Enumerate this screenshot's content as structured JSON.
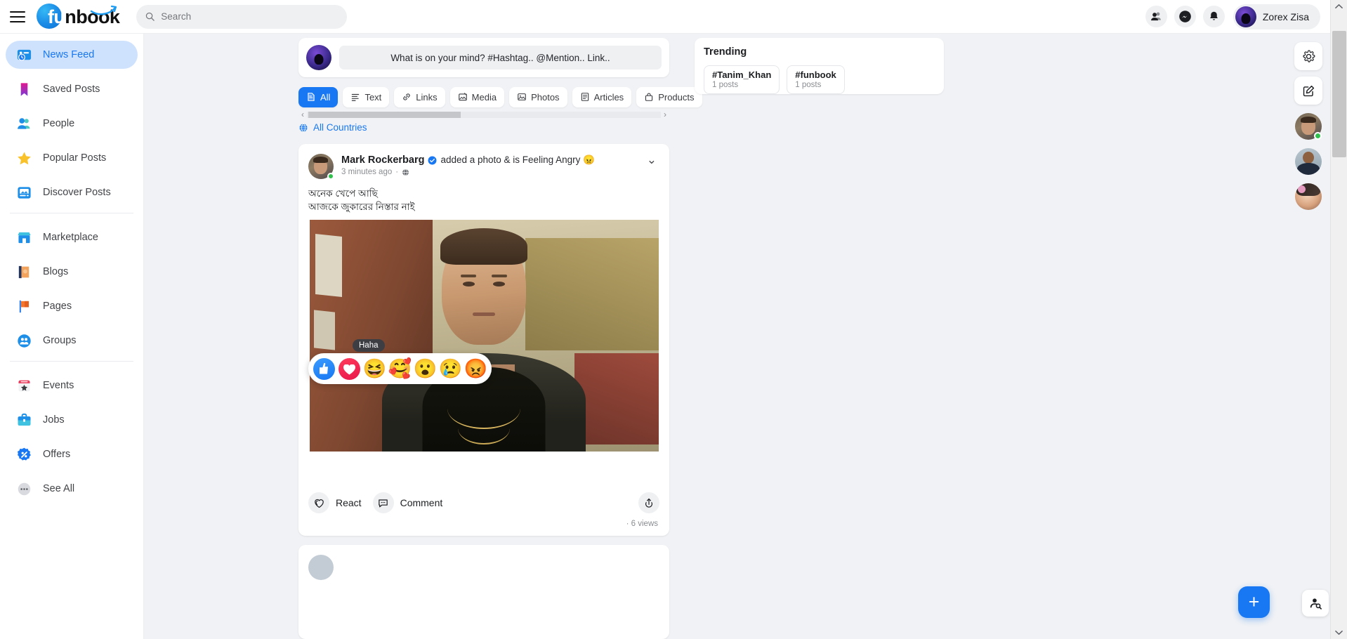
{
  "header": {
    "menu_icon": "hamburger-icon",
    "brand": {
      "prefix": "fu",
      "suffix": "nbook"
    },
    "search": {
      "placeholder": "Search",
      "icon": "search-icon"
    },
    "icons": [
      {
        "name": "friends-icon",
        "glyph": "friends"
      },
      {
        "name": "messenger-icon",
        "glyph": "messenger"
      },
      {
        "name": "notifications-icon",
        "glyph": "bell"
      }
    ],
    "user": {
      "name": "Zorex Zisa",
      "avatar_label": "ZOREX"
    }
  },
  "sidebar": {
    "items": [
      {
        "label": "News Feed",
        "icon": "news-feed-icon",
        "active": true
      },
      {
        "label": "Saved Posts",
        "icon": "bookmark-icon",
        "active": false
      },
      {
        "label": "People",
        "icon": "people-icon",
        "active": false
      },
      {
        "label": "Popular Posts",
        "icon": "star-icon",
        "active": false
      },
      {
        "label": "Discover Posts",
        "icon": "discover-icon",
        "active": false
      }
    ],
    "items2": [
      {
        "label": "Marketplace",
        "icon": "marketplace-icon"
      },
      {
        "label": "Blogs",
        "icon": "book-icon"
      },
      {
        "label": "Pages",
        "icon": "flag-icon"
      },
      {
        "label": "Groups",
        "icon": "groups-icon"
      }
    ],
    "items3": [
      {
        "label": "Events",
        "icon": "calendar-icon"
      },
      {
        "label": "Jobs",
        "icon": "briefcase-icon"
      },
      {
        "label": "Offers",
        "icon": "discount-icon"
      },
      {
        "label": "See All",
        "icon": "ellipsis-icon"
      }
    ]
  },
  "composer": {
    "placeholder": "What is on your mind? #Hashtag.. @Mention.. Link..",
    "avatar_label": "ZOREX"
  },
  "filters": {
    "tabs": [
      {
        "label": "All",
        "icon": "all-icon",
        "active": true
      },
      {
        "label": "Text",
        "icon": "text-icon",
        "active": false
      },
      {
        "label": "Links",
        "icon": "link-icon",
        "active": false
      },
      {
        "label": "Media",
        "icon": "media-icon",
        "active": false
      },
      {
        "label": "Photos",
        "icon": "photo-icon",
        "active": false
      },
      {
        "label": "Articles",
        "icon": "article-icon",
        "active": false
      },
      {
        "label": "Products",
        "icon": "product-icon",
        "active": false
      }
    ],
    "scroll_left": "‹",
    "scroll_right": "›"
  },
  "country_filter": {
    "label": "All Countries",
    "icon": "globe-icon"
  },
  "post": {
    "author": "Mark Rockerbarg",
    "verified": true,
    "action_text": "added a photo & is Feeling Angry 😠",
    "timestamp": "3 minutes ago",
    "separator": "·",
    "privacy_icon": "globe-icon",
    "more_icon": "chevron-down-icon",
    "text_line1": "অনেক খেপে আছি",
    "text_line2": "আজকে জুকারের নিস্তার নাই",
    "reaction_tooltip": "Haha",
    "reactions": [
      {
        "name": "like",
        "glyph": ""
      },
      {
        "name": "love",
        "glyph": ""
      },
      {
        "name": "haha",
        "glyph": "😆"
      },
      {
        "name": "care",
        "glyph": "🥰"
      },
      {
        "name": "wow",
        "glyph": "😮"
      },
      {
        "name": "sad",
        "glyph": "😢"
      },
      {
        "name": "angry",
        "glyph": "😡"
      }
    ],
    "react_label": "React",
    "react_icon": "heart-react-icon",
    "comment_label": "Comment",
    "comment_icon": "comment-icon",
    "share_icon": "share-icon",
    "views": "· 6 views"
  },
  "trending": {
    "title": "Trending",
    "tags": [
      {
        "name": "#Tanim_Khan",
        "count": "1 posts"
      },
      {
        "name": "#funbook",
        "count": "1 posts"
      }
    ]
  },
  "rail": {
    "settings_icon": "gear-icon",
    "compose_icon": "edit-square-icon",
    "contacts": [
      {
        "name": "contact-avatar-1",
        "online": true
      },
      {
        "name": "contact-avatar-2",
        "online": false
      },
      {
        "name": "contact-avatar-3",
        "online": false
      }
    ]
  },
  "floating": {
    "create_label": "+",
    "create_icon": "plus-icon",
    "find_people_icon": "person-search-icon"
  },
  "scrollbar": {
    "up": "⌃",
    "down": "⌄"
  },
  "colors": {
    "accent": "#1877f2",
    "page_bg": "#f0f2f5",
    "card_bg": "#ffffff",
    "text": "#1c1e21",
    "muted": "#8a8d91",
    "online": "#31c04e"
  }
}
